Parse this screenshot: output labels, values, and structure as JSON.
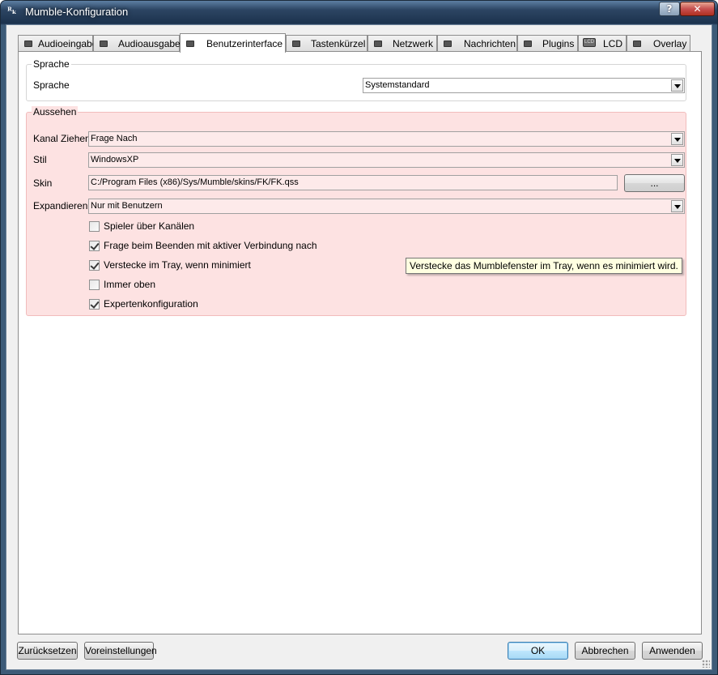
{
  "window": {
    "title": "Mumble-Konfiguration",
    "help_label": "?",
    "close_label": "✕"
  },
  "tabs": [
    {
      "label": "Audioeingabe",
      "icon": "microphone-icon",
      "active": false
    },
    {
      "label": "Audioausgabe",
      "icon": "speaker-icon",
      "active": false
    },
    {
      "label": "Benutzerinterface",
      "icon": "window-icon",
      "active": true
    },
    {
      "label": "Tastenkürzel",
      "icon": "keyboard-icon",
      "active": false
    },
    {
      "label": "Netzwerk",
      "icon": "network-icon",
      "active": false
    },
    {
      "label": "Nachrichten",
      "icon": "message-icon",
      "active": false
    },
    {
      "label": "Plugins",
      "icon": "plugin-icon",
      "active": false
    },
    {
      "label": "LCD",
      "icon": "lcd-icon",
      "active": false
    },
    {
      "label": "Overlay",
      "icon": "overlay-icon",
      "active": false
    }
  ],
  "lcd_icon_text": "LCD",
  "sprache_group": {
    "title": "Sprache",
    "label": "Sprache",
    "value": "Systemstandard"
  },
  "aussehen_group": {
    "title": "Aussehen",
    "kanal_label": "Kanal Ziehen",
    "kanal_value": "Frage Nach",
    "stil_label": "Stil",
    "stil_value": "WindowsXP",
    "skin_label": "Skin",
    "skin_value": "C:/Program Files (x86)/Sys/Mumble/skins/FK/FK.qss",
    "browse_label": "...",
    "expand_label": "Expandieren",
    "expand_value": "Nur mit Benutzern",
    "highlight_color": "#fde2e2",
    "checkboxes": [
      {
        "label": "Spieler über Kanälen",
        "checked": false
      },
      {
        "label": "Frage beim Beenden mit aktiver Verbindung nach",
        "checked": true
      },
      {
        "label": "Verstecke im Tray, wenn minimiert",
        "checked": true
      },
      {
        "label": "Immer oben",
        "checked": false
      },
      {
        "label": "Expertenkonfiguration",
        "checked": true
      }
    ]
  },
  "tooltip": "Verstecke das Mumblefenster im Tray, wenn es minimiert wird.",
  "footer": {
    "reset_label": "Zurücksetzen",
    "defaults_label": "Voreinstellungen",
    "ok_label": "OK",
    "cancel_label": "Abbrechen",
    "apply_label": "Anwenden"
  }
}
